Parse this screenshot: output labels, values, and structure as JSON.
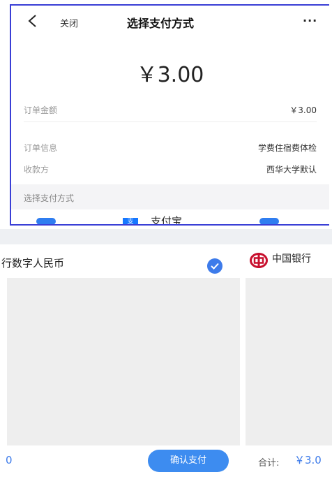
{
  "nav": {
    "back_icon": "chevron-left-icon",
    "close_label": "关闭",
    "title": "选择支付方式",
    "more_label": "···"
  },
  "amount_display": "￥3.00",
  "order": {
    "amount_label": "订单金额",
    "amount_value": "￥3.00",
    "info_label": "订单信息",
    "info_value": "学费住宿费体检",
    "payee_label": "收款方",
    "payee_value": "西华大学默认"
  },
  "method_section": {
    "header": "选择支付方式",
    "alipay_label": "支付宝"
  },
  "bottom_left": {
    "method_label": "行数字人民币",
    "amount_text": "0",
    "confirm_label": "确认支付",
    "accent": "#3d7bea"
  },
  "bottom_right": {
    "bank_label": "中国银行",
    "total_label": "合计:",
    "total_value": "￥3.0",
    "bank_color": "#c8102e"
  }
}
